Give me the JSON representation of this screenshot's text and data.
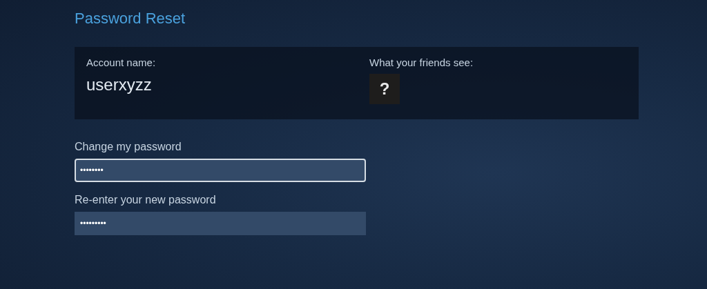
{
  "title": "Password Reset",
  "account": {
    "name_label": "Account name:",
    "name_value": "userxyzz",
    "avatar_label": "What your friends see:",
    "avatar_glyph": "?"
  },
  "fields": [
    {
      "label": "Change my password",
      "value": "••••••••",
      "focused": true
    },
    {
      "label": "Re-enter your new password",
      "value": "•••••••••",
      "focused": false
    }
  ]
}
